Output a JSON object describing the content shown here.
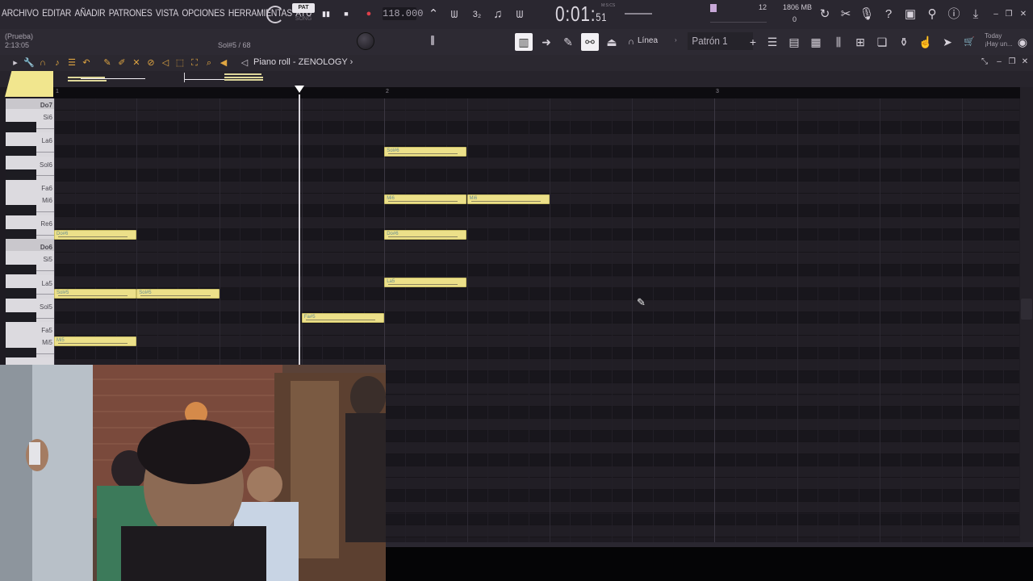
{
  "menu": [
    "ARCHIVO",
    "EDITAR",
    "AÑADIR",
    "PATRONES",
    "VISTA",
    "OPCIONES",
    "HERRAMIENTAS",
    "AYU"
  ],
  "transport": {
    "pat_label": "PAT",
    "song_label": "SONG",
    "tempo": "118.000",
    "time_main": "0:01",
    "time_sub": "51",
    "time_format": "M:S:CS"
  },
  "monitor": {
    "cpu": "12",
    "memory": "1806 MB",
    "polyphony": "0"
  },
  "hint_bar": {
    "title": "(Prueba)",
    "time": "2:13:05",
    "note_info": "Sol#5 / 68"
  },
  "toolbar2": {
    "snap_label": "Línea",
    "pattern_label": "Patrón 1",
    "pattern_add": "+",
    "news_title": "Today",
    "news_text": "¡Hay un..."
  },
  "piano_roll": {
    "title": "Piano roll - ZENOLOGY",
    "bar_numbers": [
      "1",
      "2",
      "3"
    ],
    "key_labels": [
      "Do7",
      "Si6",
      "La6",
      "Sol6",
      "Fa6",
      "Mi6",
      "Re6",
      "Do6",
      "Si5",
      "La5",
      "Sol5",
      "Fa5",
      "Mi5"
    ],
    "notes": [
      {
        "label": "Sol#6",
        "pitch": 92,
        "start": 4.0,
        "length": 1.0
      },
      {
        "label": "Mi6",
        "pitch": 88,
        "start": 4.0,
        "length": 1.0
      },
      {
        "label": "Mi6",
        "pitch": 88,
        "start": 5.0,
        "length": 1.0
      },
      {
        "label": "Do#6",
        "pitch": 85,
        "start": 0.0,
        "length": 1.0
      },
      {
        "label": "Do#6",
        "pitch": 85,
        "start": 4.0,
        "length": 1.0
      },
      {
        "label": "La5",
        "pitch": 81,
        "start": 4.0,
        "length": 1.0
      },
      {
        "label": "Sol#5",
        "pitch": 80,
        "start": 0.0,
        "length": 1.0
      },
      {
        "label": "Sol#5",
        "pitch": 80,
        "start": 1.0,
        "length": 1.0
      },
      {
        "label": "Fa#5",
        "pitch": 78,
        "start": 3.0,
        "length": 1.0
      },
      {
        "label": "Mi5",
        "pitch": 76,
        "start": 0.0,
        "length": 1.0
      }
    ],
    "playhead_beat": 2.95
  },
  "colors": {
    "note_fill": "#ece089",
    "accent_orange": "#e0a642",
    "grid_bg": "#1e1b22",
    "record_red": "#e0404a"
  },
  "icons": {
    "play": "▮▮",
    "stop": "■",
    "record": "●"
  }
}
